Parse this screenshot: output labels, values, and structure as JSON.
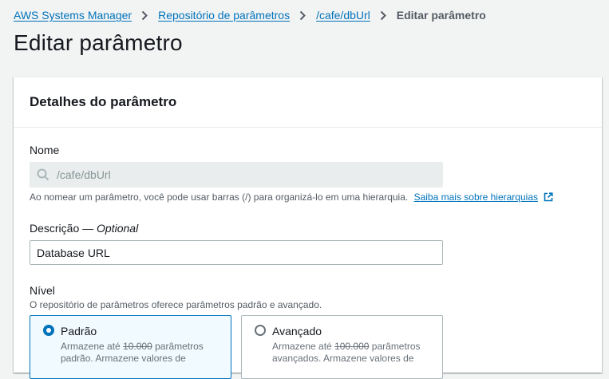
{
  "breadcrumb": {
    "items": [
      "AWS Systems Manager",
      "Repositório de parâmetros",
      "/cafe/dbUrl"
    ],
    "current": "Editar parâmetro"
  },
  "page": {
    "title": "Editar parâmetro"
  },
  "panel": {
    "title": "Detalhes do parâmetro",
    "name": {
      "label": "Nome",
      "value": "/cafe/dbUrl",
      "hint": "Ao nomear um parâmetro, você pode usar barras (/) para organizá-lo em uma hierarquia.",
      "hint_link": "Saiba mais sobre hierarquias"
    },
    "description": {
      "label": "Descrição —",
      "optional": "Optional",
      "value": "Database URL"
    },
    "tier": {
      "label": "Nível",
      "hint": "O repositório de parâmetros oferece parâmetros padrão e avançado.",
      "options": [
        {
          "label": "Padrão",
          "desc_prefix": "Armazene até",
          "desc_count": "10.000",
          "desc_suffix": "parâmetros padrão. Armazene valores de",
          "selected": true
        },
        {
          "label": "Avançado",
          "desc_prefix": "Armazene até",
          "desc_count": "100.000",
          "desc_suffix": "parâmetros avançados. Armazene valores de",
          "selected": false
        }
      ]
    }
  },
  "colors": {
    "link": "#0073bb",
    "selected_bg": "#f1faff",
    "panel_bg": "#ffffff",
    "page_bg": "#f2f3f3"
  },
  "icons": {
    "separator": "chevron-right-icon",
    "search": "search-icon",
    "external": "external-link-icon"
  }
}
